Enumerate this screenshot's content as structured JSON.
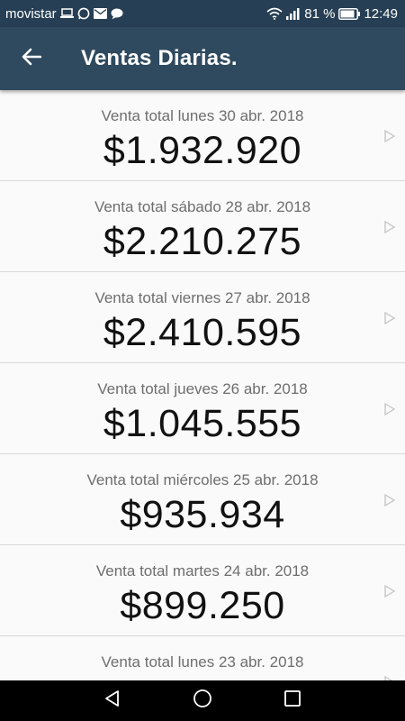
{
  "status_bar": {
    "carrier": "movistar",
    "battery": "81 %",
    "time": "12:49",
    "icons": [
      "laptop-icon",
      "whatsapp-icon",
      "mail-icon",
      "chat-icon",
      "wifi-icon",
      "signal-icon",
      "battery-icon"
    ]
  },
  "app_bar": {
    "title": "Ventas Diarias.",
    "back_icon": "arrow-left-icon",
    "background": "#2f4a5f"
  },
  "sales": [
    {
      "label": "Venta total lunes 30 abr. 2018",
      "amount": "$1.932.920"
    },
    {
      "label": "Venta total sábado 28 abr. 2018",
      "amount": "$2.210.275"
    },
    {
      "label": "Venta total viernes 27 abr. 2018",
      "amount": "$2.410.595"
    },
    {
      "label": "Venta total jueves 26 abr. 2018",
      "amount": "$1.045.555"
    },
    {
      "label": "Venta total miércoles 25 abr. 2018",
      "amount": "$935.934"
    },
    {
      "label": "Venta total martes 24 abr. 2018",
      "amount": "$899.250"
    },
    {
      "label": "Venta total lunes 23 abr. 2018",
      "amount": ""
    }
  ],
  "nav_bar": {
    "icons": [
      "back-triangle-icon",
      "home-circle-icon",
      "recents-square-icon"
    ]
  }
}
